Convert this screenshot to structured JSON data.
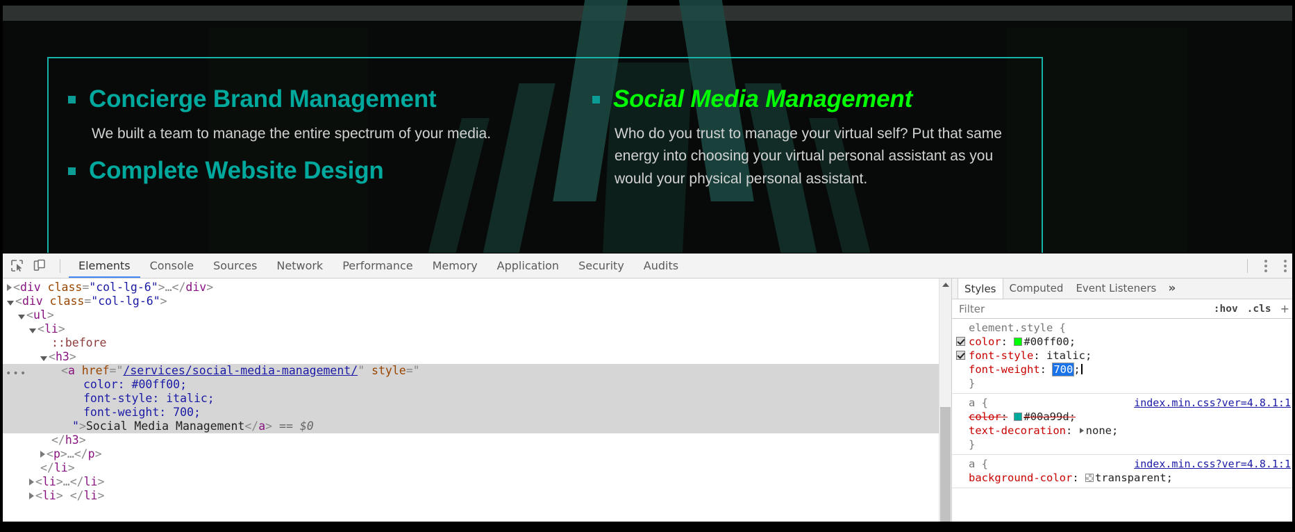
{
  "webpage": {
    "services_left": [
      {
        "title": "Concierge Brand Management",
        "desc": "We built a team to manage the entire spectrum of your media."
      },
      {
        "title": "Complete Website Design",
        "desc": ""
      }
    ],
    "services_right": [
      {
        "title": "Social Media Management",
        "desc": "Who do you trust to manage your virtual self? Put that same energy into choosing your virtual personal assistant as you would your physical personal assistant."
      }
    ],
    "colors": {
      "heading_teal": "#00a99d",
      "heading_green": "#00ff00",
      "bullet": "#0c9c96",
      "body_text": "#d2d2d2",
      "box_border": "#16b3a8",
      "page_bg": "#070a09"
    }
  },
  "devtools": {
    "toolbar": {
      "inspect_icon": "inspect-element-icon",
      "device_icon": "device-toolbar-icon",
      "kebab_icon": "more-options-icon",
      "tabs": [
        "Elements",
        "Console",
        "Sources",
        "Network",
        "Performance",
        "Memory",
        "Application",
        "Security",
        "Audits"
      ],
      "active_tab": "Elements"
    },
    "dom": {
      "rows": [
        {
          "indent": 10,
          "twisty": "right",
          "parts": [
            {
              "t": "<",
              "c": "gy"
            },
            {
              "t": "div",
              "c": "tg"
            },
            {
              "t": " class",
              "c": "at"
            },
            {
              "t": "=",
              "c": "gy"
            },
            {
              "t": "\"col-lg-6\"",
              "c": "av"
            },
            {
              "t": ">",
              "c": "gy"
            },
            {
              "t": "…",
              "c": "gy"
            },
            {
              "t": "</",
              "c": "gy"
            },
            {
              "t": "div",
              "c": "tg"
            },
            {
              "t": ">",
              "c": "gy"
            }
          ]
        },
        {
          "indent": 10,
          "twisty": "down",
          "parts": [
            {
              "t": "<",
              "c": "gy"
            },
            {
              "t": "div",
              "c": "tg"
            },
            {
              "t": " class",
              "c": "at"
            },
            {
              "t": "=",
              "c": "gy"
            },
            {
              "t": "\"col-lg-6\"",
              "c": "av"
            },
            {
              "t": ">",
              "c": "gy"
            }
          ]
        },
        {
          "indent": 26,
          "twisty": "down",
          "parts": [
            {
              "t": "<",
              "c": "gy"
            },
            {
              "t": "ul",
              "c": "tg"
            },
            {
              "t": ">",
              "c": "gy"
            }
          ]
        },
        {
          "indent": 42,
          "twisty": "down",
          "parts": [
            {
              "t": "<",
              "c": "gy"
            },
            {
              "t": "li",
              "c": "tg"
            },
            {
              "t": ">",
              "c": "gy"
            }
          ]
        },
        {
          "indent": 74,
          "twisty": "none",
          "parts": [
            {
              "t": "::before",
              "c": "pseudo"
            }
          ]
        },
        {
          "indent": 58,
          "twisty": "down",
          "parts": [
            {
              "t": "<",
              "c": "gy"
            },
            {
              "t": "h3",
              "c": "tg"
            },
            {
              "t": ">",
              "c": "gy"
            }
          ]
        },
        {
          "indent": 88,
          "twisty": "none",
          "selected": true,
          "parts": [
            {
              "t": "<",
              "c": "gy"
            },
            {
              "t": "a",
              "c": "tg"
            },
            {
              "t": " href",
              "c": "at"
            },
            {
              "t": "=\"",
              "c": "gy"
            },
            {
              "t": "/services/social-media-management/",
              "c": "lnk"
            },
            {
              "t": "\"",
              "c": "gy"
            },
            {
              "t": " style",
              "c": "at"
            },
            {
              "t": "=\"",
              "c": "gy"
            }
          ]
        },
        {
          "indent": 120,
          "twisty": "none",
          "selected": true,
          "parts": [
            {
              "t": "color: #00ff00;",
              "c": "av"
            }
          ]
        },
        {
          "indent": 120,
          "twisty": "none",
          "selected": true,
          "parts": [
            {
              "t": "font-style: italic;",
              "c": "av"
            }
          ]
        },
        {
          "indent": 120,
          "twisty": "none",
          "selected": true,
          "parts": [
            {
              "t": "font-weight: 700;",
              "c": "av"
            }
          ]
        },
        {
          "indent": 104,
          "twisty": "none",
          "selected": true,
          "parts": [
            {
              "t": "\"",
              "c": "av"
            },
            {
              "t": ">",
              "c": "gy"
            },
            {
              "t": "Social Media Management",
              "c": "txt"
            },
            {
              "t": "</",
              "c": "gy"
            },
            {
              "t": "a",
              "c": "tg"
            },
            {
              "t": ">",
              "c": "gy"
            },
            {
              "t": " == $0",
              "c": "eq"
            }
          ]
        },
        {
          "indent": 74,
          "twisty": "none",
          "parts": [
            {
              "t": "</",
              "c": "gy"
            },
            {
              "t": "h3",
              "c": "tg"
            },
            {
              "t": ">",
              "c": "gy"
            }
          ]
        },
        {
          "indent": 58,
          "twisty": "right",
          "parts": [
            {
              "t": "<",
              "c": "gy"
            },
            {
              "t": "p",
              "c": "tg"
            },
            {
              "t": ">",
              "c": "gy"
            },
            {
              "t": "…",
              "c": "gy"
            },
            {
              "t": "</",
              "c": "gy"
            },
            {
              "t": "p",
              "c": "tg"
            },
            {
              "t": ">",
              "c": "gy"
            }
          ]
        },
        {
          "indent": 58,
          "twisty": "none",
          "parts": [
            {
              "t": "</",
              "c": "gy"
            },
            {
              "t": "li",
              "c": "tg"
            },
            {
              "t": ">",
              "c": "gy"
            }
          ]
        },
        {
          "indent": 42,
          "twisty": "right",
          "parts": [
            {
              "t": "<",
              "c": "gy"
            },
            {
              "t": "li",
              "c": "tg"
            },
            {
              "t": ">",
              "c": "gy"
            },
            {
              "t": "…",
              "c": "gy"
            },
            {
              "t": "</",
              "c": "gy"
            },
            {
              "t": "li",
              "c": "tg"
            },
            {
              "t": ">",
              "c": "gy"
            }
          ]
        },
        {
          "indent": 42,
          "twisty": "right",
          "parts": [
            {
              "t": "<",
              "c": "gy"
            },
            {
              "t": "li",
              "c": "tg"
            },
            {
              "t": "> ",
              "c": "gy"
            },
            {
              "t": "</",
              "c": "gy"
            },
            {
              "t": "li",
              "c": "tg"
            },
            {
              "t": ">",
              "c": "gy"
            }
          ]
        }
      ],
      "overflow_marker": "•••"
    },
    "styles": {
      "tabs": [
        "Styles",
        "Computed",
        "Event Listeners"
      ],
      "active_tab": "Styles",
      "more_label": "»",
      "filter_placeholder": "Filter",
      "filter_value": "",
      "hov_label": ":hov",
      "cls_label": ".cls",
      "plus_label": "+",
      "rules": [
        {
          "selector": "element.style {",
          "source": "",
          "close": "}",
          "declarations": [
            {
              "checkbox": true,
              "prop": "color",
              "value": "#00ff00",
              "swatch": "#00ff00",
              "struck": false,
              "editing": false
            },
            {
              "checkbox": true,
              "prop": "font-style",
              "value": "italic",
              "swatch": "",
              "struck": false,
              "editing": false
            },
            {
              "checkbox": false,
              "prop": "font-weight",
              "value": "700",
              "swatch": "",
              "struck": false,
              "editing": true
            }
          ]
        },
        {
          "selector": "a {",
          "source": "index.min.css?ver=4.8.1:1",
          "close": "}",
          "declarations": [
            {
              "checkbox": false,
              "prop": "color",
              "value": "#00a99d",
              "swatch": "#00a99d",
              "struck": true,
              "editing": false
            },
            {
              "checkbox": false,
              "prop": "text-decoration",
              "value": "none",
              "swatch": "",
              "expandable": true,
              "struck": false,
              "editing": false
            }
          ]
        },
        {
          "selector": "a {",
          "source": "index.min.css?ver=4.8.1:1",
          "close": "",
          "declarations": [
            {
              "checkbox": false,
              "prop": "background-color",
              "value": "transparent",
              "swatch": "transparent",
              "struck": false,
              "editing": false
            }
          ]
        }
      ]
    }
  }
}
